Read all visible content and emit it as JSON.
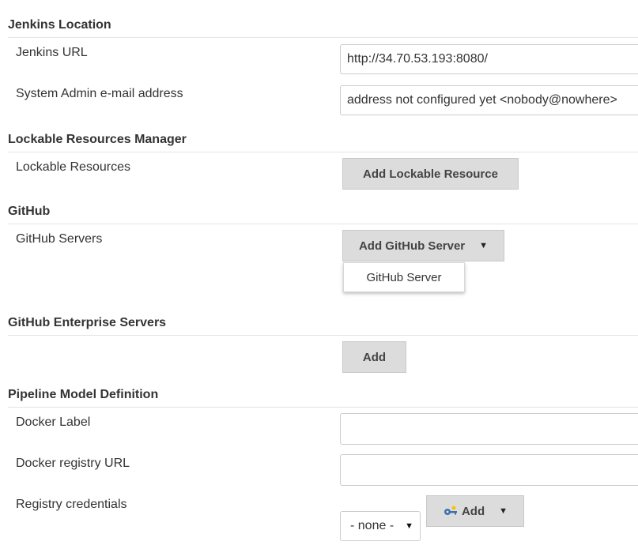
{
  "sections": {
    "jenkins_location": {
      "title": "Jenkins Location",
      "jenkins_url_label": "Jenkins URL",
      "jenkins_url_value": "http://34.70.53.193:8080/",
      "admin_email_label": "System Admin e-mail address",
      "admin_email_value": "address not configured yet <nobody@nowhere>"
    },
    "lockable_resources": {
      "title": "Lockable Resources Manager",
      "label": "Lockable Resources",
      "add_button": "Add Lockable Resource"
    },
    "github": {
      "title": "GitHub",
      "servers_label": "GitHub Servers",
      "add_button": "Add GitHub Server",
      "menu_items": [
        "GitHub Server"
      ]
    },
    "github_enterprise": {
      "title": "GitHub Enterprise Servers",
      "add_button": "Add"
    },
    "pipeline_model": {
      "title": "Pipeline Model Definition",
      "docker_label_label": "Docker Label",
      "docker_label_value": "",
      "registry_url_label": "Docker registry URL",
      "registry_url_value": "",
      "credentials_label": "Registry credentials",
      "credentials_selected": "- none -",
      "add_button": "Add"
    }
  },
  "icons": {
    "dropdown_caret": "caret-down",
    "credentials_add": "key-icon"
  },
  "colors": {
    "button_bg": "#dcdcdc",
    "border": "#cccccc",
    "rule": "#e4e4e4"
  }
}
